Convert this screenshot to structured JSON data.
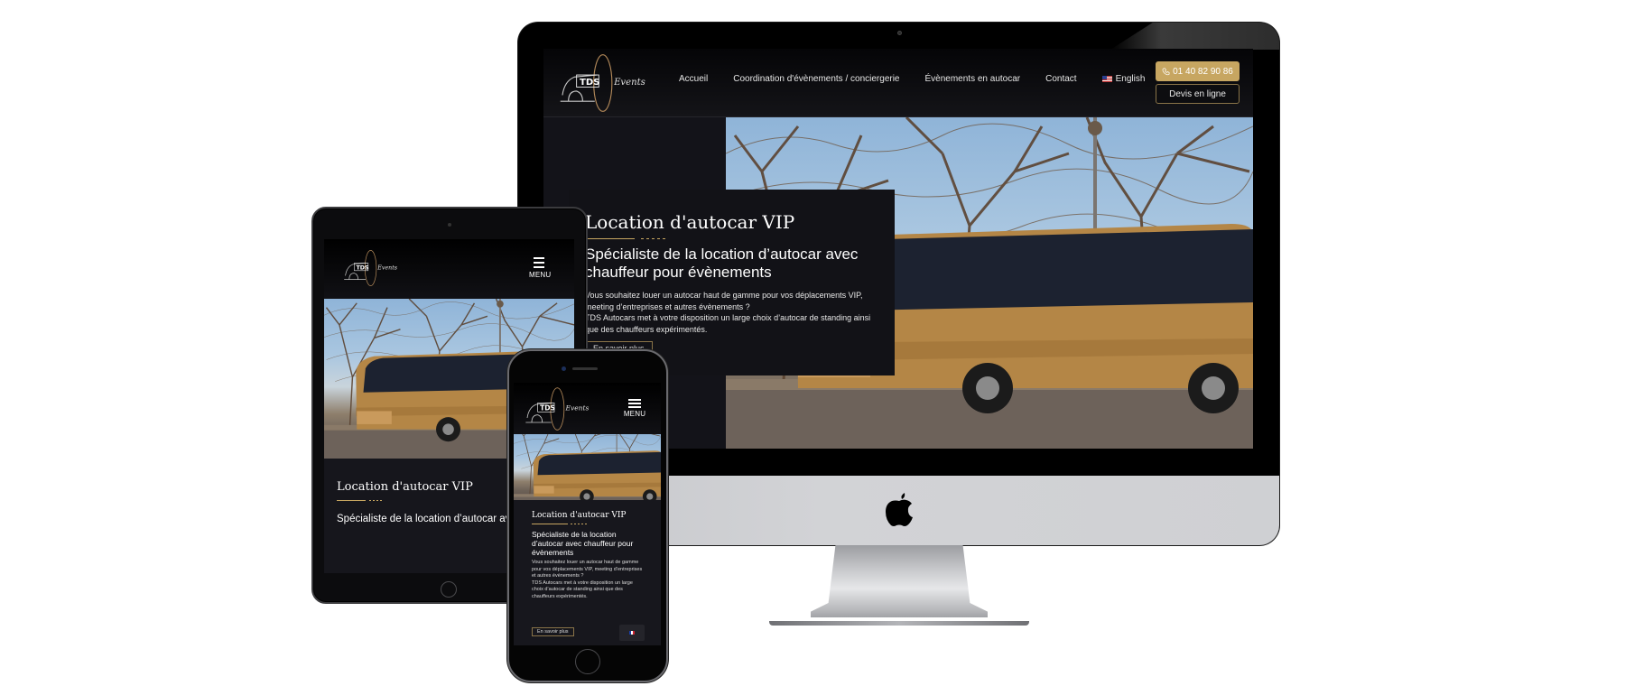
{
  "brand": {
    "logo_main": "TDS",
    "logo_script": "Events",
    "accent_color": "#c7a661",
    "background_color": "#121217"
  },
  "desktop": {
    "nav": [
      {
        "label": "Accueil"
      },
      {
        "label": "Coordination d'évènements / conciergerie"
      },
      {
        "label": "Évènements en autocar"
      },
      {
        "label": "Contact"
      },
      {
        "label": "English",
        "icon": "us-flag-icon"
      }
    ],
    "phone_button": {
      "label": "01 40 82 90 86",
      "icon": "phone-icon"
    },
    "quote_button": {
      "label": "Devis en ligne"
    },
    "hero": {
      "title": "Location d'autocar VIP",
      "subtitle": "Spécialiste de la location d’autocar avec chauffeur pour évènements",
      "text_line1": "Vous souhaitez louer un autocar haut de gamme pour vos déplacements VIP, meeting d’entreprises et autres évènements ?",
      "text_line2": "TDS Autocars met à votre disposition un large choix d’autocar de standing ainsi que des chauffeurs expérimentés.",
      "cta": "En savoir plus"
    }
  },
  "tablet": {
    "menu_label": "MENU",
    "hero": {
      "title": "Location d'autocar VIP",
      "subtitle": "Spécialiste de la location d’autocar avec chauffeur pour évènements"
    }
  },
  "mobile": {
    "menu_label": "MENU",
    "hero": {
      "title": "Location d'autocar VIP",
      "subtitle": "Spécialiste de la location d’autocar avec chauffeur pour évènements",
      "text_line1": "Vous souhaitez louer un autocar haut de gamme pour vos déplacements VIP, meeting d’entreprises et autres évènements ?",
      "text_line2": "TDS Autocars met à votre disposition un large choix d’autocar de standing ainsi que des chauffeurs expérimentés.",
      "cta": "En savoir plus"
    },
    "language_switch": {
      "icon": "fr-flag-icon"
    }
  }
}
